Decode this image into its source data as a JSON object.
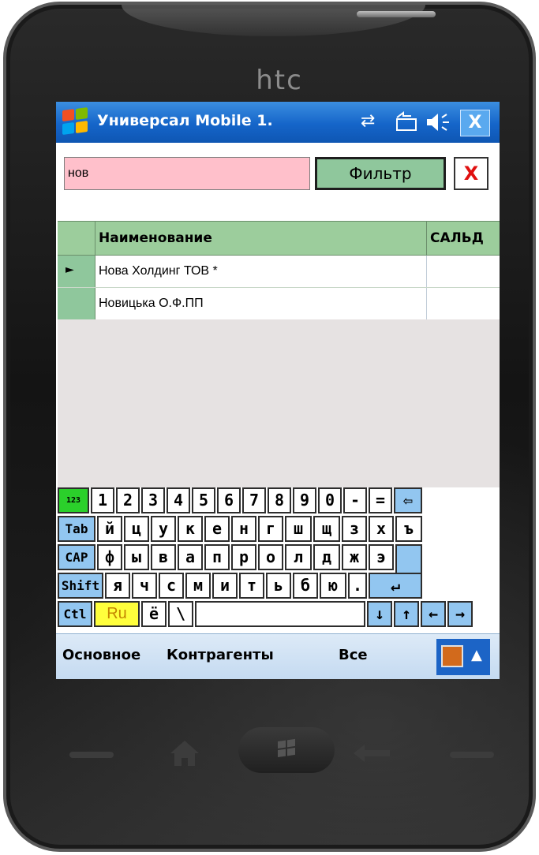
{
  "device": {
    "brand": "htc"
  },
  "titlebar": {
    "title": "Универсал Mobile 1.",
    "icons": [
      "windows-start-icon",
      "connectivity-icon",
      "sync-icon",
      "volume-icon",
      "close-icon"
    ],
    "close_label": "X"
  },
  "filter": {
    "value": "нов",
    "button_label": "Фильтр",
    "clear_label": "X"
  },
  "grid": {
    "columns": [
      "Наименование",
      "САЛЬД"
    ],
    "rows": [
      {
        "selector": "►",
        "name": "Нова Холдинг ТОВ  *",
        "saldo": ""
      },
      {
        "selector": "",
        "name": "Новицька О.Ф.ПП",
        "saldo": ""
      }
    ]
  },
  "keyboard": {
    "row1": [
      "123",
      "1",
      "2",
      "3",
      "4",
      "5",
      "6",
      "7",
      "8",
      "9",
      "0",
      "-",
      "=",
      "⇦"
    ],
    "row2": [
      "Tab",
      "й",
      "ц",
      "у",
      "к",
      "е",
      "н",
      "г",
      "ш",
      "щ",
      "з",
      "х",
      "ъ"
    ],
    "row3": [
      "CAP",
      "ф",
      "ы",
      "в",
      "а",
      "п",
      "р",
      "о",
      "л",
      "д",
      "ж",
      "э"
    ],
    "row4": [
      "Shift",
      "я",
      "ч",
      "с",
      "м",
      "и",
      "т",
      "ь",
      "б",
      "ю",
      ".",
      "↵"
    ],
    "row5": [
      "Ctl",
      "Ru",
      "ё",
      "\\",
      " ",
      "↓",
      "↑",
      "←",
      "→"
    ]
  },
  "menubar": {
    "items": [
      "Основное",
      "Контрагенты",
      "Все"
    ],
    "sip_arrow": "▲"
  },
  "colors": {
    "titlebar": "#1565c9",
    "filter_input_bg": "#ffc0cb",
    "grid_header": "#9ccd9c",
    "key_blue": "#92c6f0",
    "key_lang": "#ffff3c"
  }
}
